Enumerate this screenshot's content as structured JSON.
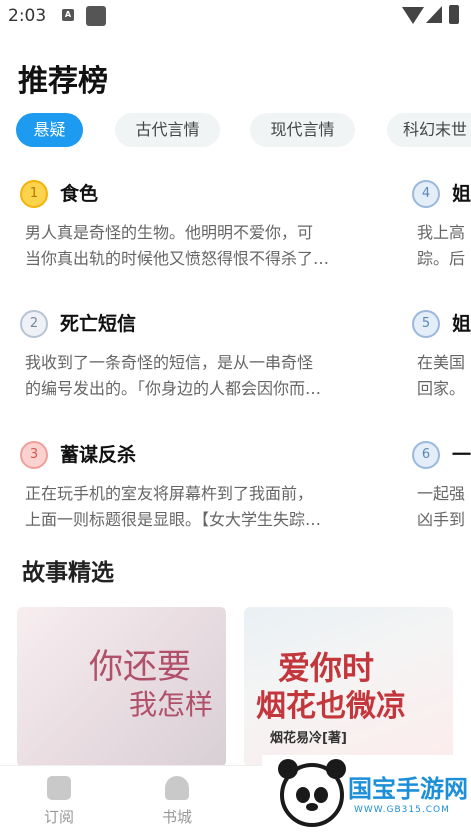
{
  "status_bar": {
    "time": "2:03",
    "notification_letter": "A"
  },
  "page": {
    "title": "推荐榜"
  },
  "chips": [
    {
      "label": "悬疑",
      "active": true
    },
    {
      "label": "古代言情",
      "active": false
    },
    {
      "label": "现代言情",
      "active": false
    },
    {
      "label": "科幻末世",
      "active": false
    }
  ],
  "ranking": {
    "left": [
      {
        "rank": "1",
        "title": "食色",
        "desc_1": "男人真是奇怪的生物。他明明不爱你，可",
        "desc_2": "当你真出轨的时候他又愤怒得恨不得杀了…"
      },
      {
        "rank": "2",
        "title": "死亡短信",
        "desc_1": "我收到了一条奇怪的短信，是从一串奇怪",
        "desc_2": "的编号发出的。「你身边的人都会因你而…"
      },
      {
        "rank": "3",
        "title": "蓄谋反杀",
        "desc_1": "正在玩手机的室友将屏幕杵到了我面前，",
        "desc_2": "上面一则标题很是显眼。【女大学生失踪…"
      }
    ],
    "right": [
      {
        "rank": "4",
        "title": "姐",
        "desc_1": "我上高",
        "desc_2": "踪。后"
      },
      {
        "rank": "5",
        "title": "姐",
        "desc_1": "在美国",
        "desc_2": "回家。"
      },
      {
        "rank": "6",
        "title": "一",
        "desc_1": "一起强",
        "desc_2": "凶手到"
      }
    ]
  },
  "stories": {
    "title": "故事精选",
    "covers": [
      {
        "line1": "你还要",
        "line2": "我怎样"
      },
      {
        "line1": "爱你时",
        "line2": "烟花也微凉",
        "author": "烟花易冷[著]"
      }
    ]
  },
  "bottom_nav": [
    {
      "label": "订阅"
    },
    {
      "label": "书城"
    }
  ],
  "watermark": {
    "brand": "国宝手游网",
    "url": "WWW.GB315.COM"
  },
  "colors": {
    "accent": "#1d9bf0",
    "gold": "#fbd34d",
    "bronze": "#fbd2cf"
  }
}
